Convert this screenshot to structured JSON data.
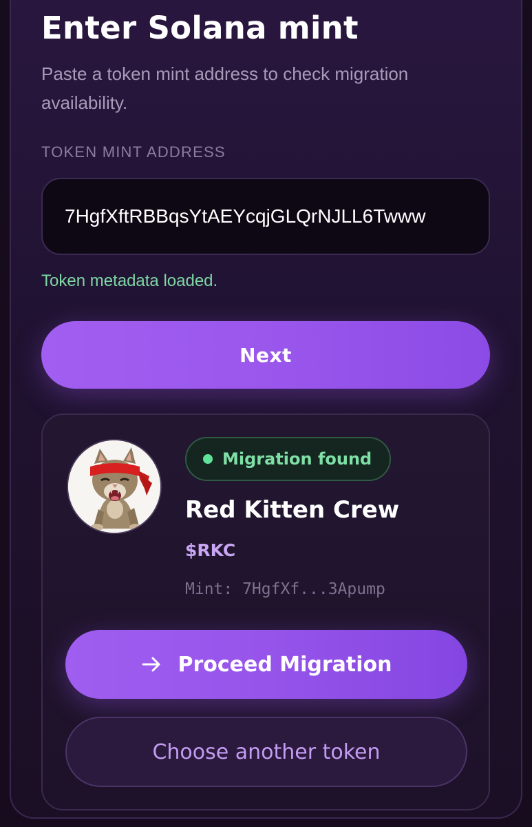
{
  "header": {
    "title": "Enter Solana mint",
    "subtitle": "Paste a token mint address to check migration availability."
  },
  "mint_field": {
    "label": "TOKEN MINT ADDRESS",
    "value": "7HgfXftRBBqsYtAEYcqjGLQrNJLL6Twww"
  },
  "status": {
    "message": "Token metadata loaded.",
    "color": "#7fd6a4"
  },
  "next_button": {
    "label": "Next"
  },
  "result": {
    "avatar_icon": "red-headband-kitten-avatar",
    "badge": "Migration found",
    "badge_color": "#7fe0a7",
    "token_name": "Red Kitten Crew",
    "token_symbol": "$RKC",
    "mint_display": "Mint: 7HgfXf...3Apump",
    "proceed_icon": "arrow-right-icon",
    "proceed_label": "Proceed Migration",
    "choose_label": "Choose another token"
  },
  "theme": {
    "accent": "#9b57ec",
    "background": "#1a0f22"
  }
}
